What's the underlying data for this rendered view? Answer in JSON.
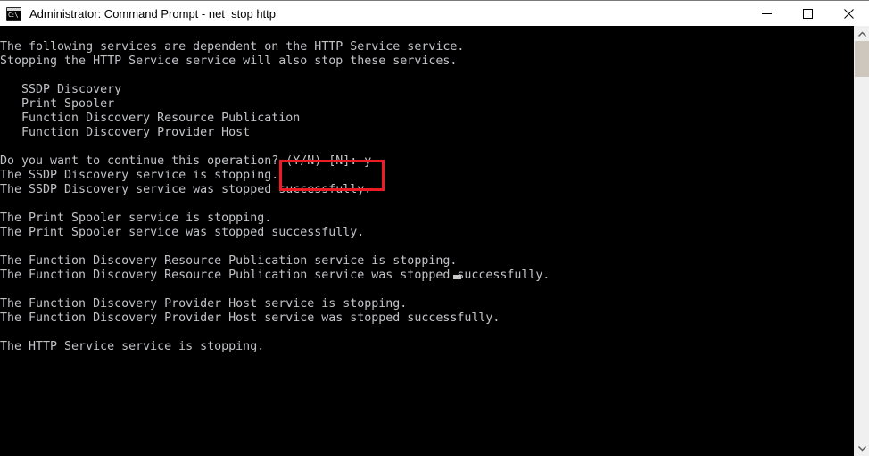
{
  "window": {
    "title": "Administrator: Command Prompt - net  stop http",
    "icon": "command-prompt-icon",
    "icon_glyph": "C:\\",
    "controls": {
      "minimize_label": "Minimize",
      "maximize_label": "Maximize",
      "close_label": "Close"
    }
  },
  "colors": {
    "titlebar_background": "#ffffff",
    "titlebar_text": "#000000",
    "console_background": "#000000",
    "console_text": "#c2c3c7",
    "annotation_border": "#ed1c24",
    "scrollbar_track": "#f0f0f0",
    "scrollbar_thumb": "#cdc7bd",
    "cursor": "#c8c8c8"
  },
  "console": {
    "output": "The following services are dependent on the HTTP Service service.\nStopping the HTTP Service service will also stop these services.\n\n   SSDP Discovery\n   Print Spooler\n   Function Discovery Resource Publication\n   Function Discovery Provider Host\n\nDo you want to continue this operation? (Y/N) [N]: y\nThe SSDP Discovery service is stopping.\nThe SSDP Discovery service was stopped successfully.\n\nThe Print Spooler service is stopping.\nThe Print Spooler service was stopped successfully.\n\nThe Function Discovery Resource Publication service is stopping.\nThe Function Discovery Resource Publication service was stopped successfully.\n\nThe Function Discovery Provider Host service is stopping.\nThe Function Discovery Provider Host service was stopped successfully.\n\nThe HTTP Service service is stopping.",
    "lines": [
      "The following services are dependent on the HTTP Service service.",
      "Stopping the HTTP Service service will also stop these services.",
      "",
      "   SSDP Discovery",
      "   Print Spooler",
      "   Function Discovery Resource Publication",
      "   Function Discovery Provider Host",
      "",
      "Do you want to continue this operation? (Y/N) [N]: y",
      "The SSDP Discovery service is stopping.",
      "The SSDP Discovery service was stopped successfully.",
      "",
      "The Print Spooler service is stopping.",
      "The Print Spooler service was stopped successfully.",
      "",
      "The Function Discovery Resource Publication service is stopping.",
      "The Function Discovery Resource Publication service was stopped successfully.",
      "",
      "The Function Discovery Provider Host service is stopping.",
      "The Function Discovery Provider Host service was stopped successfully.",
      "",
      "The HTTP Service service is stopping."
    ],
    "prompt_question": "Do you want to continue this operation?",
    "prompt_options": "(Y/N) [N]:",
    "prompt_answer": "y"
  },
  "annotation": {
    "label": "highlight-prompt-answer",
    "target_text": "(Y/N) [N]: y"
  },
  "scrollbar": {
    "up_arrow": "chevron-up-icon",
    "down_arrow": "chevron-down-icon",
    "thumb": "scrollbar-thumb"
  }
}
